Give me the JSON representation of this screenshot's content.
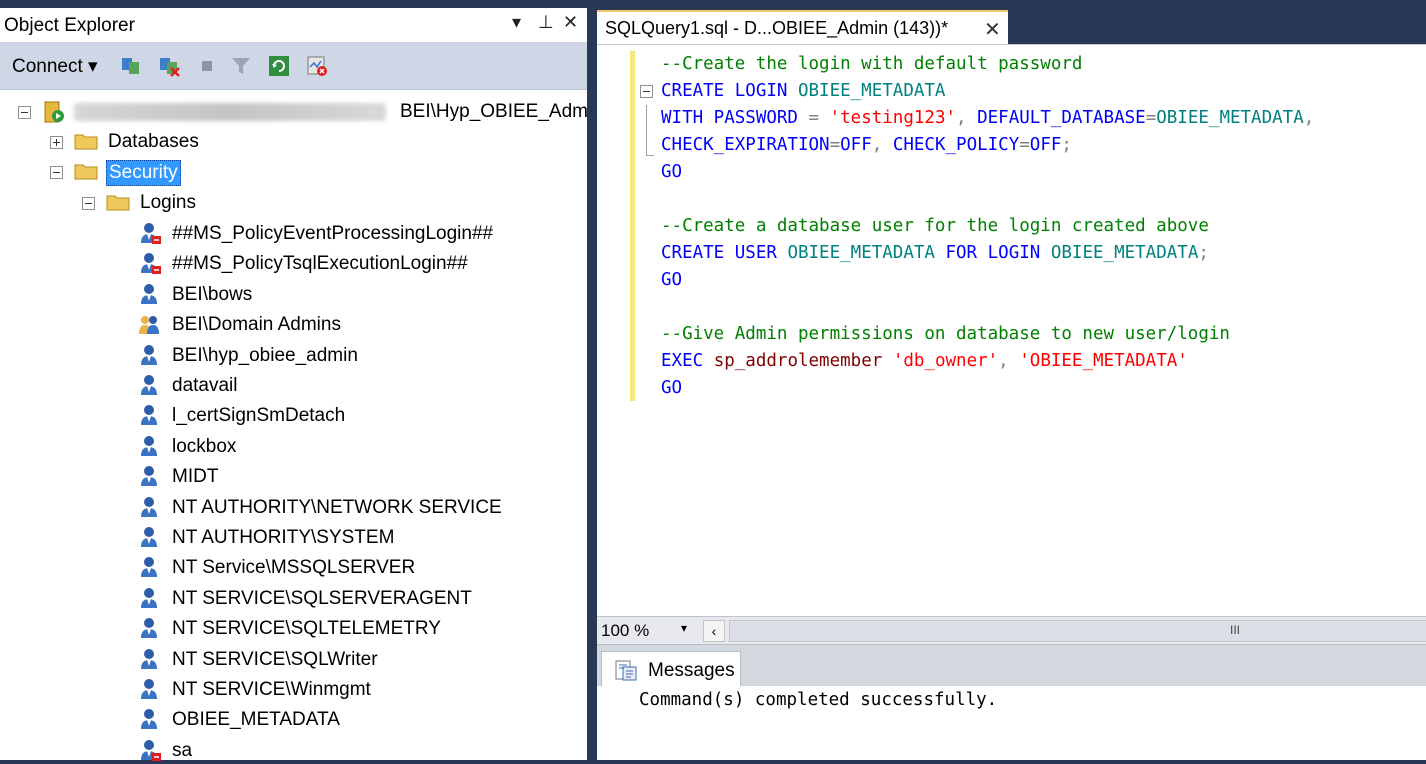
{
  "object_explorer": {
    "title": "Object Explorer",
    "controls": {
      "dropdown": "▾",
      "pin": "⊥",
      "close": "✕"
    },
    "toolbar": {
      "connect": "Connect ▾"
    },
    "server_label": "BEI\\Hyp_OBIEE_Adm",
    "nodes": {
      "databases": "Databases",
      "security": "Security",
      "logins": "Logins"
    },
    "logins": [
      {
        "name": "##MS_PolicyEventProcessingLogin##",
        "icon": "login-disabled-icon"
      },
      {
        "name": "##MS_PolicyTsqlExecutionLogin##",
        "icon": "login-disabled-icon"
      },
      {
        "name": "BEI\\bows",
        "icon": "login-icon"
      },
      {
        "name": "BEI\\Domain Admins",
        "icon": "group-login-icon"
      },
      {
        "name": "BEI\\hyp_obiee_admin",
        "icon": "login-icon"
      },
      {
        "name": "datavail",
        "icon": "login-icon"
      },
      {
        "name": "l_certSignSmDetach",
        "icon": "login-icon"
      },
      {
        "name": "lockbox",
        "icon": "login-icon"
      },
      {
        "name": "MIDT",
        "icon": "login-icon"
      },
      {
        "name": "NT AUTHORITY\\NETWORK SERVICE",
        "icon": "login-icon"
      },
      {
        "name": "NT AUTHORITY\\SYSTEM",
        "icon": "login-icon"
      },
      {
        "name": "NT Service\\MSSQLSERVER",
        "icon": "login-icon"
      },
      {
        "name": "NT SERVICE\\SQLSERVERAGENT",
        "icon": "login-icon"
      },
      {
        "name": "NT SERVICE\\SQLTELEMETRY",
        "icon": "login-icon"
      },
      {
        "name": "NT SERVICE\\SQLWriter",
        "icon": "login-icon"
      },
      {
        "name": "NT SERVICE\\Winmgmt",
        "icon": "login-icon"
      },
      {
        "name": "OBIEE_METADATA",
        "icon": "login-icon"
      },
      {
        "name": "sa",
        "icon": "login-disabled-icon"
      }
    ]
  },
  "editor": {
    "tab_title": "SQLQuery1.sql - D...OBIEE_Admin (143))*",
    "tab_close": "✕",
    "code": {
      "l1_comment": "--Create the login with default password",
      "l2_kw1": "CREATE LOGIN ",
      "l2_id1": "OBIEE_METADATA",
      "l3_kw1": "WITH PASSWORD ",
      "l3_op1": "= ",
      "l3_st1": "'testing123'",
      "l3_op2": ", ",
      "l3_kw2": "DEFAULT_DATABASE",
      "l3_op3": "=",
      "l3_id1": "OBIEE_METADATA",
      "l3_op4": ",",
      "l4_kw1": "CHECK_EXPIRATION",
      "l4_op1": "=",
      "l4_kw2": "OFF",
      "l4_op2": ", ",
      "l4_kw3": "CHECK_POLICY",
      "l4_op3": "=",
      "l4_kw4": "OFF",
      "l4_op4": ";",
      "l5_kw1": "GO",
      "l7_comment": "--Create a database user for the login created above",
      "l8_kw1": "CREATE USER ",
      "l8_id1": "OBIEE_METADATA",
      "l8_kw2": " FOR LOGIN ",
      "l8_id2": "OBIEE_METADATA",
      "l8_op1": ";",
      "l9_kw1": "GO",
      "l11_comment": "--Give Admin permissions on database to new user/login",
      "l12_kw1": "EXEC ",
      "l12_fn1": "sp_addrolemember ",
      "l12_st1": "'db_owner'",
      "l12_op1": ", ",
      "l12_st2": "'OBIEE_METADATA'",
      "l13_kw1": "GO"
    },
    "zoom": "100 %",
    "zoom_drop": "▾",
    "scroll_left": "‹",
    "scroll_grip": "III"
  },
  "messages": {
    "tab_label": "Messages",
    "text": "Command(s) completed successfully."
  },
  "colors": {
    "selection": "#3399ff",
    "keyword": "#0000ff",
    "comment": "#008000",
    "string": "#ff0000",
    "identifier": "#008080"
  }
}
